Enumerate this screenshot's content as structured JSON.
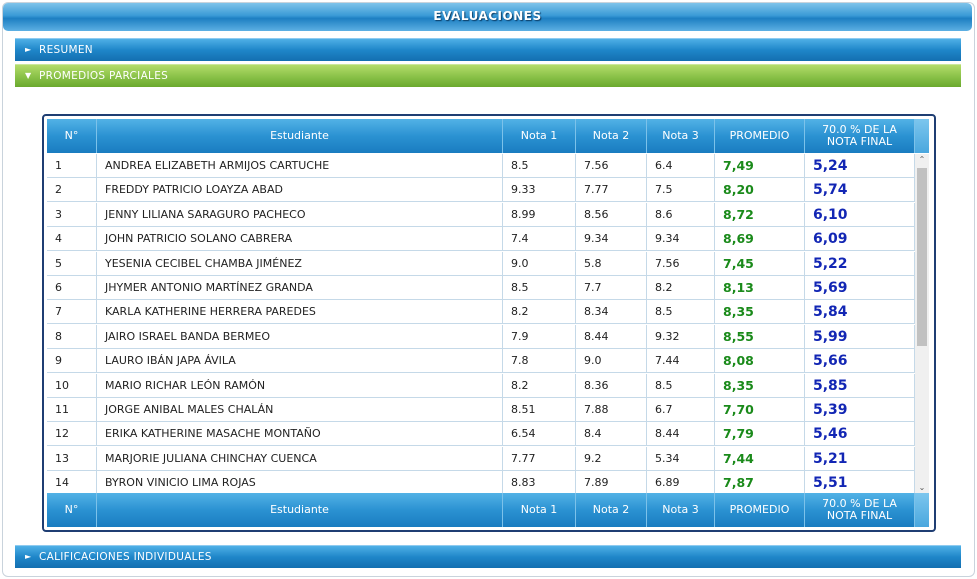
{
  "page": {
    "title": "EVALUACIONES"
  },
  "accordion": {
    "resumen": "RESUMEN",
    "promedios": "PROMEDIOS PARCIALES",
    "calificaciones": "CALIFICACIONES INDIVIDUALES"
  },
  "table": {
    "headers": [
      "N°",
      "Estudiante",
      "Nota 1",
      "Nota 2",
      "Nota 3",
      "PROMEDIO",
      "70.0 % DE LA NOTA FINAL"
    ],
    "footers": [
      "N°",
      "Estudiante",
      "Nota 1",
      "Nota 2",
      "Nota 3",
      "PROMEDIO",
      "70.0 % DE LA NOTA FINAL"
    ],
    "rows": [
      [
        "1",
        "ANDREA ELIZABETH ARMIJOS CARTUCHE",
        "8.5",
        "7.56",
        "6.4",
        "7,49",
        "5,24"
      ],
      [
        "2",
        "FREDDY PATRICIO LOAYZA ABAD",
        "9.33",
        "7.77",
        "7.5",
        "8,20",
        "5,74"
      ],
      [
        "3",
        "JENNY LILIANA SARAGURO PACHECO",
        "8.99",
        "8.56",
        "8.6",
        "8,72",
        "6,10"
      ],
      [
        "4",
        "JOHN PATRICIO SOLANO CABRERA",
        "7.4",
        "9.34",
        "9.34",
        "8,69",
        "6,09"
      ],
      [
        "5",
        "YESENIA CECIBEL CHAMBA JIMÉNEZ",
        "9.0",
        "5.8",
        "7.56",
        "7,45",
        "5,22"
      ],
      [
        "6",
        "JHYMER ANTONIO MARTÍNEZ GRANDA",
        "8.5",
        "7.7",
        "8.2",
        "8,13",
        "5,69"
      ],
      [
        "7",
        "KARLA KATHERINE HERRERA PAREDES",
        "8.2",
        "8.34",
        "8.5",
        "8,35",
        "5,84"
      ],
      [
        "8",
        "JAIRO ISRAEL BANDA BERMEO",
        "7.9",
        "8.44",
        "9.32",
        "8,55",
        "5,99"
      ],
      [
        "9",
        "LAURO IBÁN JAPA ÁVILA",
        "7.8",
        "9.0",
        "7.44",
        "8,08",
        "5,66"
      ],
      [
        "10",
        "MARIO RICHAR LEÓN RAMÓN",
        "8.2",
        "8.36",
        "8.5",
        "8,35",
        "5,85"
      ],
      [
        "11",
        "JORGE ANIBAL MALES CHALÁN",
        "8.51",
        "7.88",
        "6.7",
        "7,70",
        "5,39"
      ],
      [
        "12",
        "ERIKA KATHERINE MASACHE MONTAÑO",
        "6.54",
        "8.4",
        "8.44",
        "7,79",
        "5,46"
      ],
      [
        "13",
        "MARJORIE JULIANA CHINCHAY CUENCA",
        "7.77",
        "9.2",
        "5.34",
        "7,44",
        "5,21"
      ],
      [
        "14",
        "BYRON VINICIO LIMA ROJAS",
        "8.83",
        "7.89",
        "6.89",
        "7,87",
        "5,51"
      ]
    ]
  },
  "icons": {
    "collapsed": "chevron-right-icon",
    "expanded": "chevron-down-icon",
    "scroll_up": "scroll-up-icon",
    "scroll_down": "scroll-down-icon"
  },
  "colors": {
    "accent_blue": "#1f86c9",
    "accent_green": "#8cc34a",
    "average_text": "#1a8a1a",
    "final_text": "#1226b4"
  }
}
